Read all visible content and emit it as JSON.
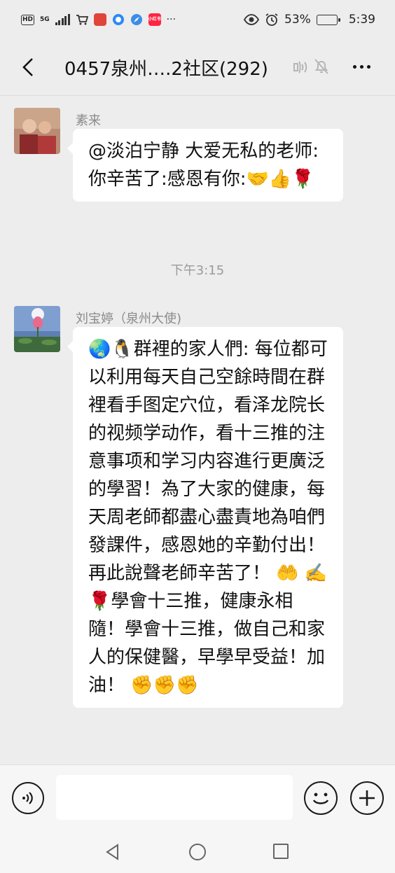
{
  "status_bar": {
    "hd": "HD",
    "network": "5G",
    "app_icons": [
      "cart-icon",
      "book-icon",
      "browser-icon",
      "compass-icon",
      "xiaohongshu-icon"
    ],
    "xiaohongshu_label": "小红书",
    "more": "···",
    "battery_percent": "53%",
    "battery_level": 0.53,
    "time": "5:39"
  },
  "header": {
    "title": "0457泉州….2社区(292)"
  },
  "messages": [
    {
      "sender": "素来",
      "text": "@淡泊宁静 大爱无私的老师:你辛苦了:感恩有你:🤝👍🌹"
    },
    {
      "timestamp": "下午3:15"
    },
    {
      "sender": "刘宝婷（泉州大使)",
      "text": "🌏🐧群裡的家人們: 每位都可以利用每天自己空餘時間在群裡看手图定穴位，看泽龙院长的视频学动作，看十三推的注意事项和学习内容進行更廣泛的學習！為了大家的健康，每天周老師都盡心盡責地為咱們發課件，感恩她的辛勤付出！再此說聲老師辛苦了！ 🤲 ✍️\n🌹學會十三推，健康永相隨！學會十三推，做自己和家人的保健醫，早學早受益！加油！ ✊✊✊"
    }
  ],
  "input_bar": {
    "placeholder": ""
  },
  "colors": {
    "background": "#ededed",
    "bubble": "#ffffff",
    "name": "#8a8a8a",
    "bar": "#f6f6f6"
  }
}
